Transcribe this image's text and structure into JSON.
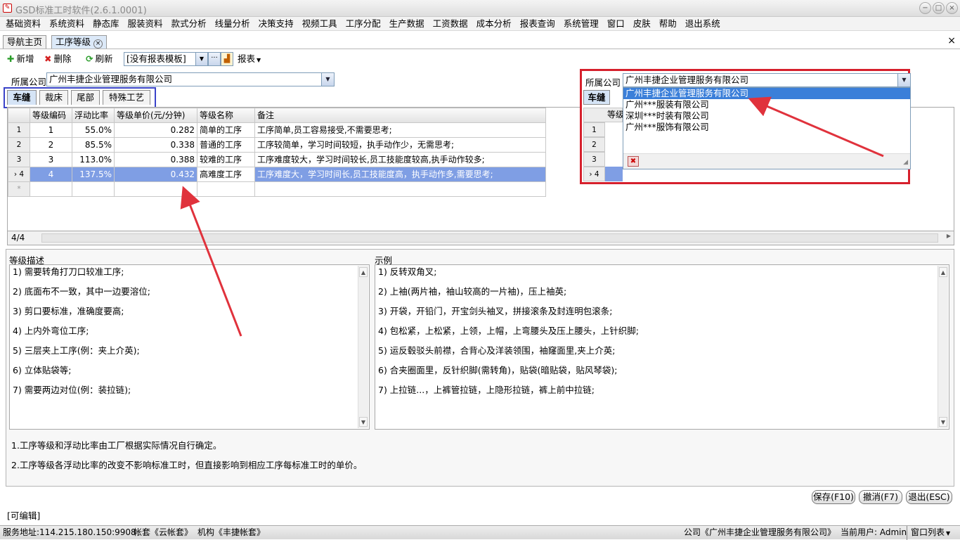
{
  "window": {
    "title": "GSD标准工时软件(2.6.1.0001)",
    "minimize": "−",
    "maximize": "□",
    "close": "×"
  },
  "menu": [
    "基础资料",
    "系统资料",
    "静态库",
    "服装资料",
    "款式分析",
    "线量分析",
    "决策支持",
    "视频工具",
    "工序分配",
    "生产数据",
    "工资数据",
    "成本分析",
    "报表查询",
    "系统管理",
    "窗口",
    "皮肤",
    "帮助",
    "退出系统"
  ],
  "doc_tabs": {
    "home": "导航主页",
    "active": "工序等级",
    "close_glyph": "×",
    "strip_close": "×"
  },
  "toolbar": {
    "add": "新增",
    "delete": "删除",
    "refresh": "刷新",
    "report_template": "[没有报表模板]",
    "more": "···",
    "report": "报表"
  },
  "company": {
    "label": "所属公司",
    "value": "广州丰捷企业管理服务有限公司"
  },
  "sub_tabs": [
    "车缝",
    "裁床",
    "尾部",
    "特殊工艺"
  ],
  "grid": {
    "columns": [
      "等级编码",
      "浮动比率",
      "等级单价(元/分钟)",
      "等级名称",
      "备注"
    ],
    "rows": [
      {
        "rn": "1",
        "code": "1",
        "ratio": "55.0%",
        "price": "0.282",
        "name": "简单的工序",
        "note": "工序简单,员工容易接受,不需要思考;"
      },
      {
        "rn": "2",
        "code": "2",
        "ratio": "85.5%",
        "price": "0.338",
        "name": "普通的工序",
        "note": "工序较简单，学习时间较短，执手动作少，无需思考;"
      },
      {
        "rn": "3",
        "code": "3",
        "ratio": "113.0%",
        "price": "0.388",
        "name": "较难的工序",
        "note": "工序难度较大，学习时间较长,员工技能度较高,执手动作较多;"
      },
      {
        "rn": "4",
        "code": "4",
        "ratio": "137.5%",
        "price": "0.432",
        "name": "高难度工序",
        "note": "工序难度大，学习时间长,员工技能度高，执手动作多,需要思考;"
      }
    ],
    "selected_marker": "›",
    "new_row_marker": "*",
    "record_count": "4/4"
  },
  "level_desc": {
    "title": "等级描述",
    "lines": [
      "1) 需要转角打刀口较准工序;",
      "2) 底面布不一致，其中一边要溶位;",
      "3) 剪口要标准，准确度要高;",
      "4) 上内外弯位工序;",
      "5) 三层夹上工序(例：夹上介英);",
      "6) 立体贴袋等;",
      "7) 需要两边对位(例：装拉链);"
    ]
  },
  "example": {
    "title": "示例",
    "lines": [
      "1) 反转双角叉;",
      "2) 上袖(两片袖，袖山较高的一片袖)，压上袖英;",
      "3) 开袋，开铅门，开宝剑头袖叉，拼接滚条及封连明包滚条;",
      "4) 包松紧，上松紧，上领，上帽，上弯腰头及压上腰头，上针织脚;",
      "5) 运反毂驳头前襟，合背心及洋装领围，袖窿面里,夹上介英;",
      "6) 合夹圈面里，反针织脚(需转角)，贴袋(暗贴袋，贴风琴袋);",
      "7) 上拉链...，上裤管拉链，上隐形拉链，裤上前中拉链;"
    ]
  },
  "notes": [
    "1.工序等级和浮动比率由工厂根据实际情况自行确定。",
    "2.工序等级各浮动比率的改变不影响标准工时，但直接影响到相应工序每标准工时的单价。"
  ],
  "buttons": {
    "save": "保存(F10)",
    "cancel": "撤消(F7)",
    "exit": "退出(ESC)"
  },
  "editable_status": "[可编辑]",
  "statusbar": {
    "server": "服务地址:114.215.180.150:9908",
    "account": "帐套《云帐套》",
    "org": "机构《丰捷帐套》",
    "company": "公司《广州丰捷企业管理服务有限公司》",
    "user": "当前用户: Admin",
    "window_list": "窗口列表"
  },
  "popup": {
    "label": "所属公司",
    "value": "广州丰捷企业管理服务有限公司",
    "options": [
      "广州丰捷企业管理服务有限公司",
      "广州***服装有限公司",
      "深圳***时装有限公司",
      "广州***服饰有限公司"
    ],
    "tab_visible": "车缝",
    "grid_header": "等级",
    "row_numbers": [
      "1",
      "2",
      "3",
      "4"
    ],
    "selected_marker": "›"
  },
  "colors": {
    "highlight_border_red": "#d6202c",
    "highlight_border_blue": "#3a43c9",
    "selection_blue": "#7f9ee4",
    "arrow_red": "#e0323c"
  }
}
